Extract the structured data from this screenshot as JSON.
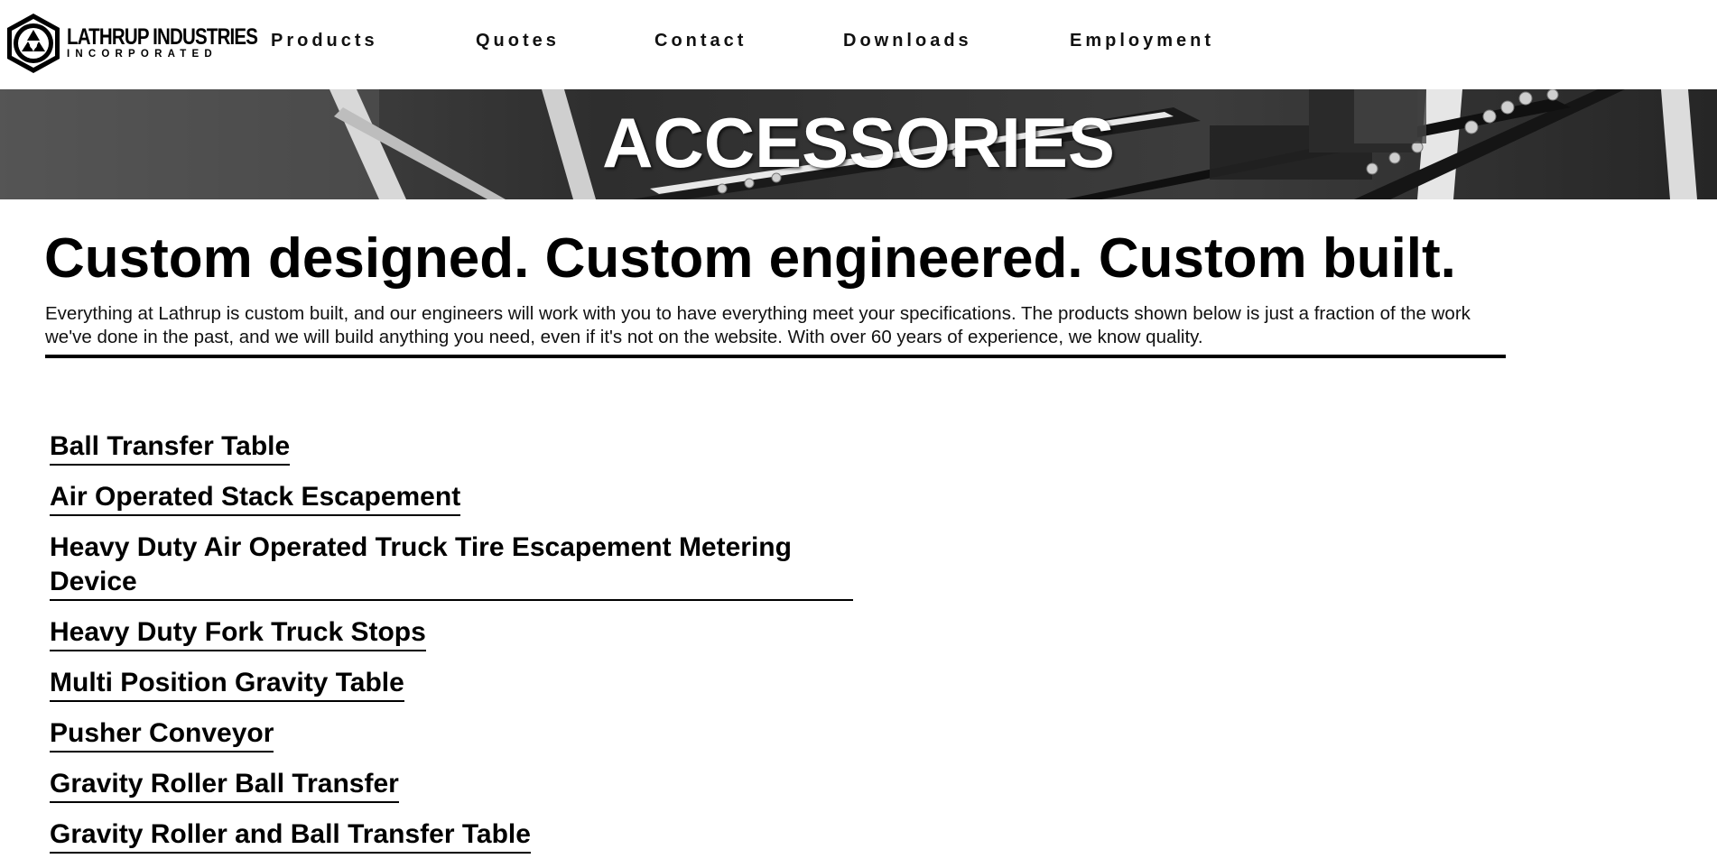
{
  "header": {
    "logo": {
      "name": "LATHRUP INDUSTRIES",
      "subtitle": "INCORPORATED",
      "icon": "lathrup-hexagon-logo-icon"
    },
    "nav": [
      {
        "label": "Products"
      },
      {
        "label": "Quotes"
      },
      {
        "label": "Contact"
      },
      {
        "label": "Downloads"
      },
      {
        "label": "Employment"
      }
    ]
  },
  "banner": {
    "title": "ACCESSORIES"
  },
  "main": {
    "headline": "Custom designed. Custom engineered. Custom built.",
    "intro": "Everything at Lathrup is custom built, and our engineers will work with you to have everything meet your specifications. The products shown below is just a fraction of the work we've done in the past, and we will build anything you need, even if it's not on the website. With over 60 years of experience, we know quality.",
    "products": [
      {
        "label": "Ball Transfer Table"
      },
      {
        "label": "Air Operated Stack Escapement"
      },
      {
        "label": "Heavy Duty Air Operated Truck Tire Escapement Metering Device"
      },
      {
        "label": "Heavy Duty Fork Truck Stops"
      },
      {
        "label": "Multi Position Gravity Table"
      },
      {
        "label": "Pusher Conveyor"
      },
      {
        "label": "Gravity Roller Ball Transfer"
      },
      {
        "label": "Gravity Roller and Ball Transfer Table"
      }
    ]
  },
  "colors": {
    "text": "#000000",
    "background": "#ffffff",
    "banner_text": "#ffffff"
  }
}
